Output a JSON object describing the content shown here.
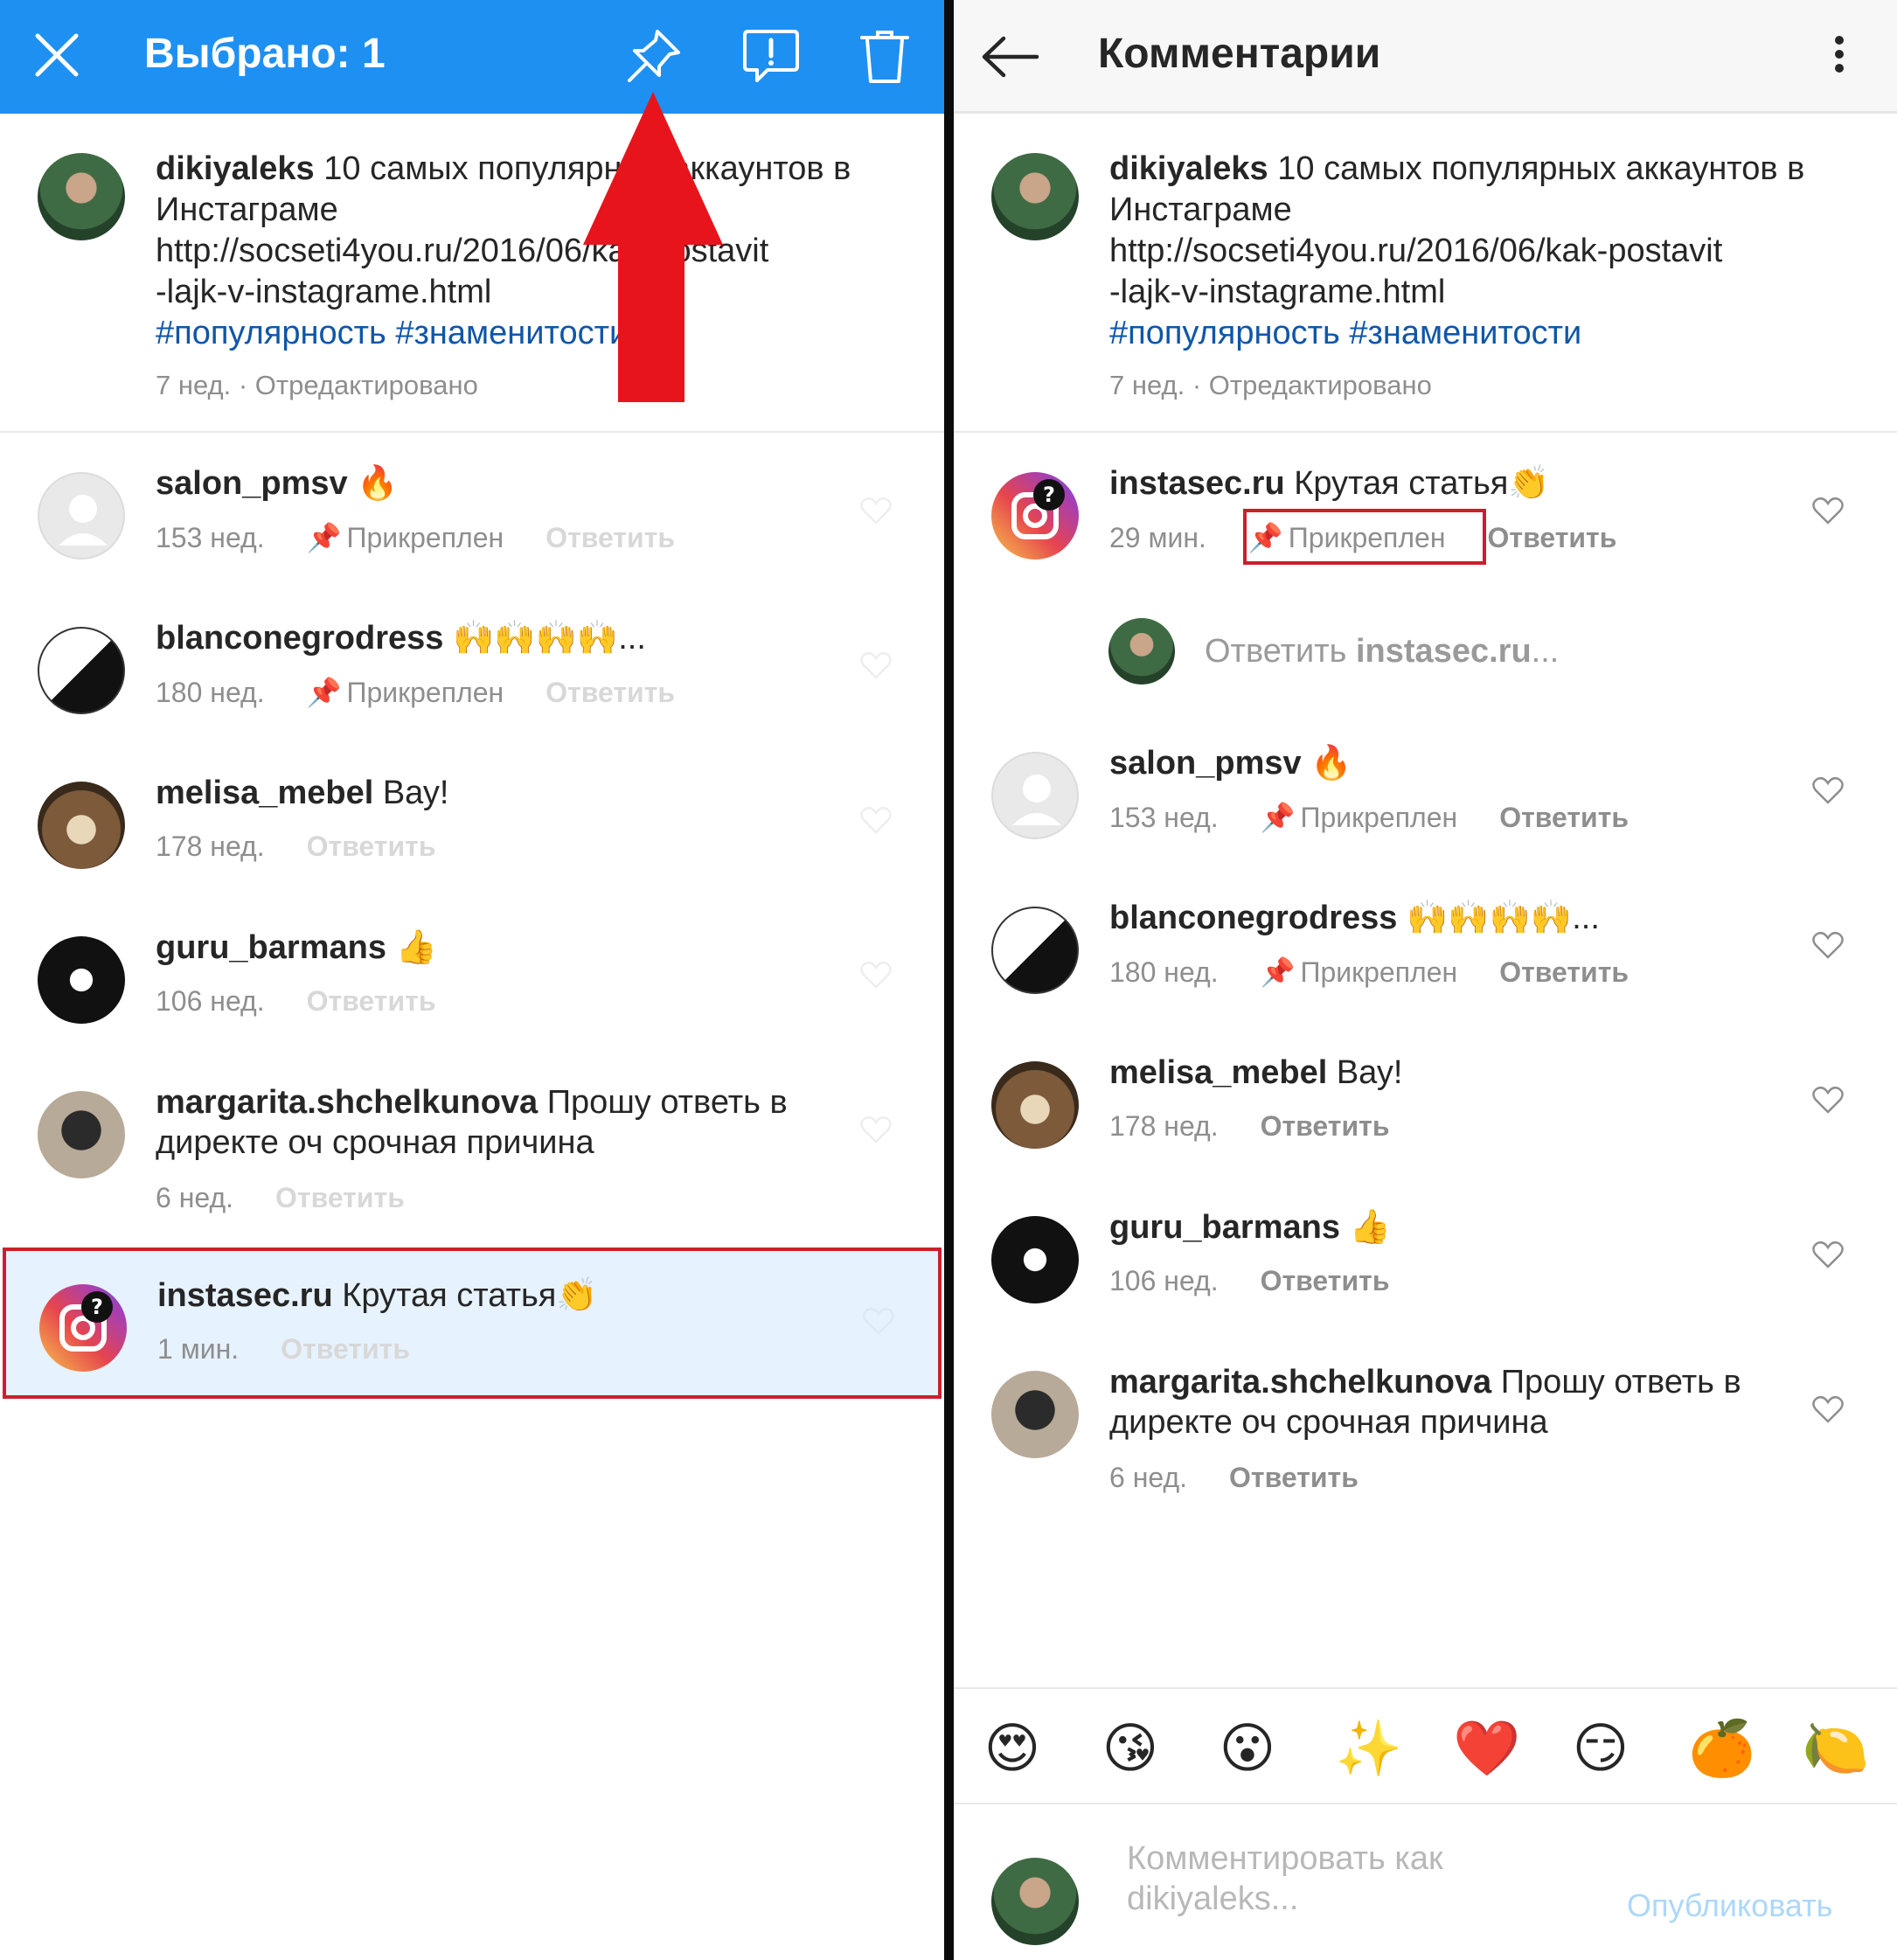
{
  "left": {
    "header": {
      "title": "Выбрано: 1"
    },
    "post": {
      "user": "dikiyaleks",
      "line1": "10 самых популярных аккаунтов в",
      "line2": "Инстаграме",
      "line3": "http://socseti4you.ru/2016/06/kak-postavit",
      "line4": "-lajk-v-instagrame.html",
      "tags": "#популярность #знаменитости",
      "meta": "7 нед. · Отредактировано"
    },
    "comments": [
      {
        "user": "salon_pmsv",
        "text": "🔥",
        "time": "153 нед.",
        "pinned": "Прикреплен",
        "reply": "Ответить"
      },
      {
        "user": "blanconegrodress",
        "text": "🙌🙌🙌🙌...",
        "time": "180 нед.",
        "pinned": "Прикреплен",
        "reply": "Ответить"
      },
      {
        "user": "melisa_mebel",
        "text": "Вау!",
        "time": "178 нед.",
        "reply": "Ответить"
      },
      {
        "user": "guru_barmans",
        "text": "👍",
        "time": "106 нед.",
        "reply": "Ответить"
      },
      {
        "user": "margarita.shchelkunova",
        "text": "Прошу ответь в директе оч срочная причина",
        "time": "6 нед.",
        "reply": "Ответить"
      },
      {
        "user": "instasec.ru",
        "text": "Крутая статья👏",
        "time": "1 мин.",
        "reply": "Ответить"
      }
    ]
  },
  "right": {
    "header": {
      "title": "Комментарии"
    },
    "post": {
      "user": "dikiyaleks",
      "line1": "10 самых популярных аккаунтов в",
      "line2": "Инстаграме",
      "line3": "http://socseti4you.ru/2016/06/kak-postavit",
      "line4": "-lajk-v-instagrame.html",
      "tags": "#популярность #знаменитости",
      "meta": "7 нед. · Отредактировано"
    },
    "comments": [
      {
        "user": "instasec.ru",
        "text": "Крутая статья👏",
        "time": "29 мин.",
        "pinned": "Прикреплен",
        "reply": "Ответить"
      },
      {
        "user": "salon_pmsv",
        "text": "🔥",
        "time": "153 нед.",
        "pinned": "Прикреплен",
        "reply": "Ответить"
      },
      {
        "user": "blanconegrodress",
        "text": "🙌🙌🙌🙌...",
        "time": "180 нед.",
        "pinned": "Прикреплен",
        "reply": "Ответить"
      },
      {
        "user": "melisa_mebel",
        "text": "Вау!",
        "time": "178 нед.",
        "reply": "Ответить"
      },
      {
        "user": "guru_barmans",
        "text": "👍",
        "time": "106 нед.",
        "reply": "Ответить"
      },
      {
        "user": "margarita.shchelkunova",
        "text": "Прошу ответь в директе оч срочная причина",
        "time": "6 нед.",
        "reply": "Ответить"
      }
    ],
    "reply_prompt": {
      "prefix": "Ответить ",
      "user": "instasec.ru",
      "suffix": "..."
    },
    "emojis": [
      "😍",
      "😘",
      "😮",
      "✨",
      "❤️",
      "😏",
      "🍊",
      "🍋"
    ],
    "compose": {
      "placeholder_line1": "Комментировать как",
      "placeholder_line2": "dikiyaleks...",
      "publish": "Опубликовать"
    }
  },
  "colors": {
    "blue": "#1e90f2",
    "red": "#cc1f2d",
    "link_blue": "#0f56a8"
  }
}
